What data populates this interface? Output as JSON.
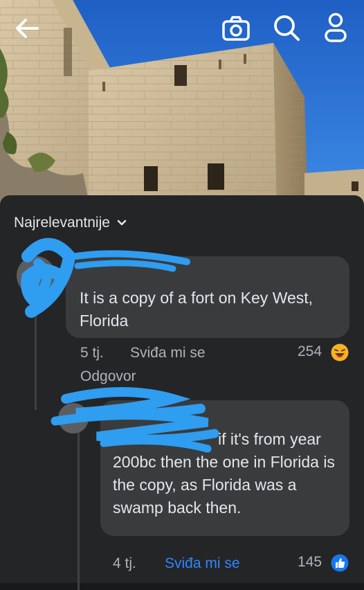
{
  "icons": {
    "back": "arrow-left-icon",
    "camera": "camera-icon",
    "search": "search-icon",
    "profile": "person-icon"
  },
  "sort": {
    "label": "Najrelevantnije",
    "icon": "chevron-down-icon"
  },
  "comments": [
    {
      "text": "It is a copy of a fort on Key West, Florida",
      "time": "5 tj.",
      "like_label": "Sviđa mi se",
      "reply_label": "Odgovor",
      "reaction_count": "254",
      "reaction": "haha-icon"
    },
    {
      "text_lead": "if it's from",
      "text_rest": "year 200bc then the one in Florida is the copy,  as Florida was a swamp back then.",
      "time": "4 tj.",
      "like_label": "Sviđa mi se",
      "reaction_count": "145",
      "reaction": "like-icon"
    }
  ],
  "colors": {
    "sheet": "#242526",
    "bubble": "#3a3b3c",
    "text": "#e4e6eb",
    "meta": "#b0b3b8",
    "accent": "#2d88ff",
    "scribble": "#2f9df0"
  }
}
